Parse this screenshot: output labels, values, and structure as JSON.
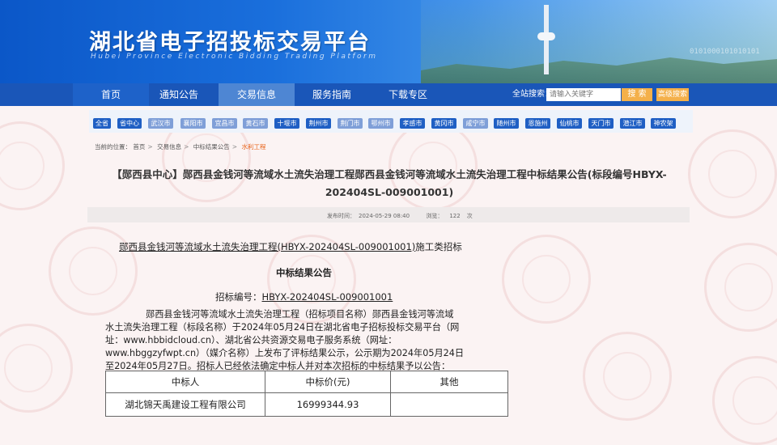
{
  "header": {
    "title": "湖北省电子招投标交易平台",
    "subtitle": "Hubei Province Electronic Bidding Trading Platform",
    "binary_decor": "0101000101010101"
  },
  "nav": {
    "items": [
      "首页",
      "通知公告",
      "交易信息",
      "服务指南",
      "下载专区"
    ],
    "active": "交易信息",
    "search_label": "全站搜索：",
    "search_placeholder": "请输入关键字",
    "search_button": "搜 索",
    "advanced_button": "高级搜索"
  },
  "regions": [
    "全省",
    "省中心",
    "武汉市",
    "襄阳市",
    "宜昌市",
    "黄石市",
    "十堰市",
    "荆州市",
    "荆门市",
    "鄂州市",
    "孝感市",
    "黄冈市",
    "咸宁市",
    "随州市",
    "恩施州",
    "仙桃市",
    "天门市",
    "潜江市",
    "神农架"
  ],
  "breadcrumb": {
    "label": "当前的位置：",
    "items": [
      "首页",
      "交易信息",
      "中标结果公告",
      "水利工程"
    ]
  },
  "article": {
    "title": "【郧西县中心】郧西县金钱河等流域水土流失治理工程郧西县金钱河等流域水土流失治理工程中标结果公告(标段编号HBYX-202404SL-009001001)",
    "publish_time_label": "发布时间：",
    "publish_time": "2024-05-29 08:40",
    "views_label": "浏览：",
    "views": "122",
    "views_unit": "次"
  },
  "doc": {
    "project_name": "郧西县金钱河等流域水土流失治理工程(HBYX-202404SL-009001001)",
    "project_suffix": "施工类招标",
    "heading": "中标结果公告",
    "code_label": "招标编号：",
    "code": "HBYX-202404SL-009001001",
    "paragraph_lines": [
      "郧西县金钱河等流域水土流失治理工程（招标项目名称）郧西县金钱河等流域",
      "水土流失治理工程（标段名称）于2024年05月24日在湖北省电子招标投标交易平台（网",
      "址：www.hbbidcloud.cn）、湖北省公共资源交易电子服务系统（网址：",
      "www.hbggzyfwpt.cn）（媒介名称）上发布了评标结果公示，公示期为2024年05月24日",
      "至2024年05月27日。招标人已经依法确定中标人并对本次招标的中标结果予以公告："
    ],
    "table": {
      "headers": [
        "中标人",
        "中标价(元)",
        "其他"
      ],
      "rows": [
        [
          "湖北锦天禹建设工程有限公司",
          "16999344.93",
          ""
        ]
      ]
    }
  }
}
